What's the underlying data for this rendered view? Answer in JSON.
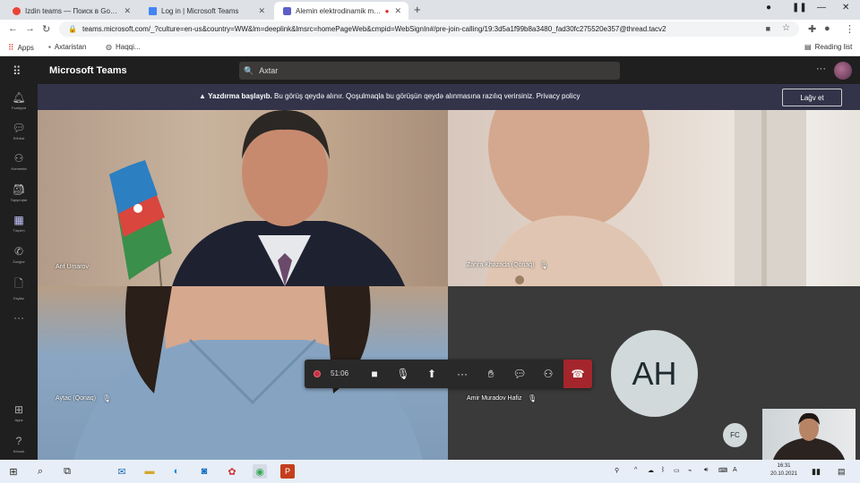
{
  "browser": {
    "tabs": [
      {
        "label": "Izdin teams — Поиск в Google",
        "favicon_color": "#ea4335"
      },
      {
        "label": "Log in | Microsoft Teams",
        "favicon_color": "#4285f4"
      },
      {
        "label": "Alemin elektrodinamik mac...",
        "favicon_color": "#5b5fc7"
      }
    ],
    "url": "teams.microsoft.com/_?culture=en-us&country=WW&lm=deeplink&lmsrc=homePageWeb&cmpid=WebSignIn#/pre-join-calling/19:3d5a1f99b8a3480_fad30fc275520e357@thread.tacv2",
    "bookmarks": [
      "Apps",
      "Axtaristan",
      "Haqqi..."
    ],
    "reading_list": "Reading list"
  },
  "teams": {
    "title": "Microsoft Teams",
    "search_placeholder": "Axtar",
    "rail": [
      "Fəaliyyət",
      "Söhbət",
      "Komanda",
      "Tapşırıqlar",
      "Təqvim",
      "Zənglər",
      "Fayllar",
      "Apps",
      "Kömək"
    ]
  },
  "banner": {
    "title": "Yazdırma başlayıb.",
    "text": "Bu görüş qeydə alınır. Qoşulmaqla bu görüşün qeydə alınmasına razılıq verirsiniz. Privacy policy",
    "cancel": "Lağv et"
  },
  "participants": {
    "tile1": "Arif Umarov",
    "tile2": "Zahra Khazada (Qonaq)",
    "tile3": "Aytac (Qonaq)",
    "tile4": "Amir Muradov Hafiz",
    "tile4_initials": "AH",
    "small_initials": "FC"
  },
  "controls": {
    "timer": "51:06"
  },
  "clock": {
    "time": "16:31",
    "date": "20.10.2021"
  }
}
